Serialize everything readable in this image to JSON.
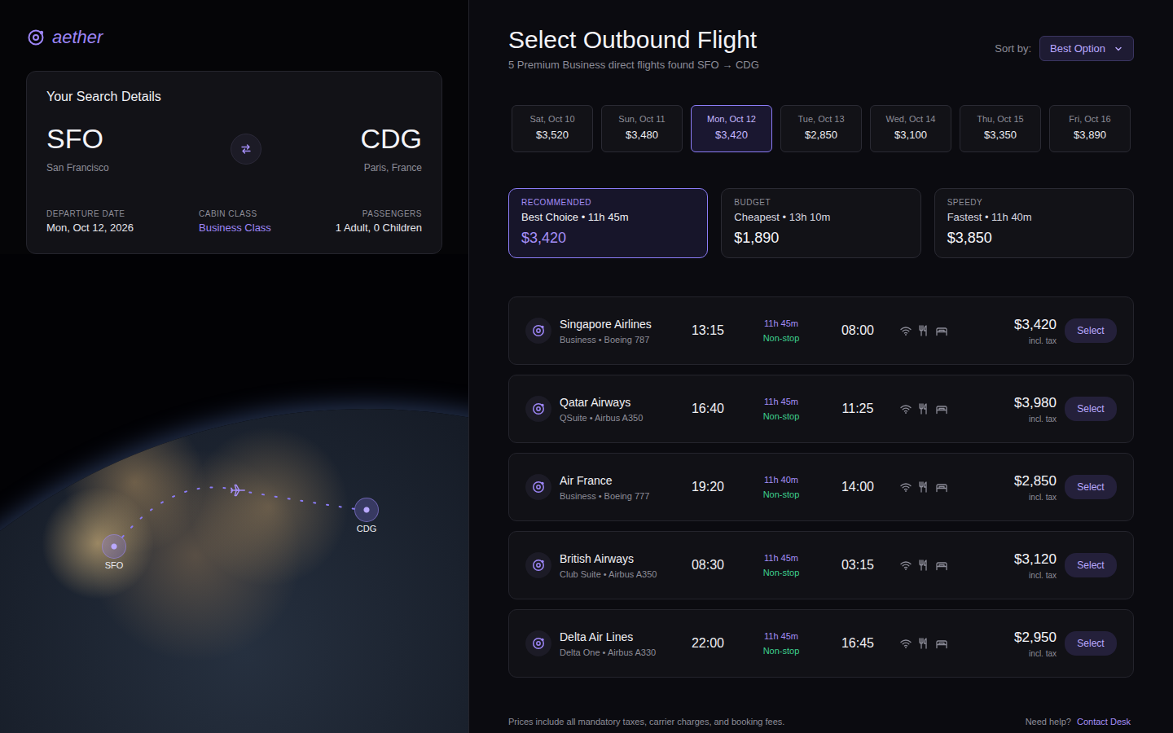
{
  "brand": {
    "name": "aether"
  },
  "search": {
    "title": "Your Search Details",
    "origin": {
      "code": "SFO",
      "city": "San Francisco"
    },
    "destination": {
      "code": "CDG",
      "city": "Paris, France"
    },
    "fields": [
      {
        "label": "DEPARTURE DATE",
        "value": "Mon, Oct 12, 2026",
        "kind": "text"
      },
      {
        "label": "CABIN CLASS",
        "value": "Business Class",
        "kind": "link"
      },
      {
        "label": "PASSENGERS",
        "value": "1 Adult, 0 Children",
        "kind": "text"
      }
    ]
  },
  "map": {
    "origin": "SFO",
    "destination": "CDG"
  },
  "header": {
    "title": "Select Outbound Flight",
    "subtitle": "5 Premium Business direct flights found SFO → CDG",
    "sort_label": "Sort by:",
    "sort_value": "Best Option"
  },
  "dates": [
    {
      "day": "Sat, Oct 10",
      "price": "$3,520",
      "selected": false
    },
    {
      "day": "Sun, Oct 11",
      "price": "$3,480",
      "selected": false
    },
    {
      "day": "Mon, Oct 12",
      "price": "$3,420",
      "selected": true
    },
    {
      "day": "Tue, Oct 13",
      "price": "$2,850",
      "selected": false
    },
    {
      "day": "Wed, Oct 14",
      "price": "$3,100",
      "selected": false
    },
    {
      "day": "Thu, Oct 15",
      "price": "$3,350",
      "selected": false
    },
    {
      "day": "Fri, Oct 16",
      "price": "$3,890",
      "selected": false
    }
  ],
  "summaries": [
    {
      "tag": "RECOMMENDED",
      "label": "Best Choice • 11h 45m",
      "price": "$3,420",
      "selected": true
    },
    {
      "tag": "BUDGET",
      "label": "Cheapest • 13h 10m",
      "price": "$1,890",
      "selected": false
    },
    {
      "tag": "SPEEDY",
      "label": "Fastest • 11h 40m",
      "price": "$3,850",
      "selected": false
    }
  ],
  "flights": [
    {
      "airline": "Singapore Airlines",
      "detail": "Business • Boeing 787",
      "depart": "13:15",
      "duration": "11h 45m",
      "stops": "Non-stop",
      "arrive": "08:00",
      "price": "$3,420",
      "tax": "incl. tax",
      "button": "Select"
    },
    {
      "airline": "Qatar Airways",
      "detail": "QSuite • Airbus A350",
      "depart": "16:40",
      "duration": "11h 45m",
      "stops": "Non-stop",
      "arrive": "11:25",
      "price": "$3,980",
      "tax": "incl. tax",
      "button": "Select"
    },
    {
      "airline": "Air France",
      "detail": "Business • Boeing 777",
      "depart": "19:20",
      "duration": "11h 40m",
      "stops": "Non-stop",
      "arrive": "14:00",
      "price": "$2,850",
      "tax": "incl. tax",
      "button": "Select"
    },
    {
      "airline": "British Airways",
      "detail": "Club Suite • Airbus A350",
      "depart": "08:30",
      "duration": "11h 45m",
      "stops": "Non-stop",
      "arrive": "03:15",
      "price": "$3,120",
      "tax": "incl. tax",
      "button": "Select"
    },
    {
      "airline": "Delta Air Lines",
      "detail": "Delta One • Airbus A330",
      "depart": "22:00",
      "duration": "11h 45m",
      "stops": "Non-stop",
      "arrive": "16:45",
      "price": "$2,950",
      "tax": "incl. tax",
      "button": "Select"
    }
  ],
  "footer": {
    "note": "Prices include all mandatory taxes, carrier charges, and booking fees.",
    "help": "Need help?",
    "link": "Contact Desk"
  }
}
